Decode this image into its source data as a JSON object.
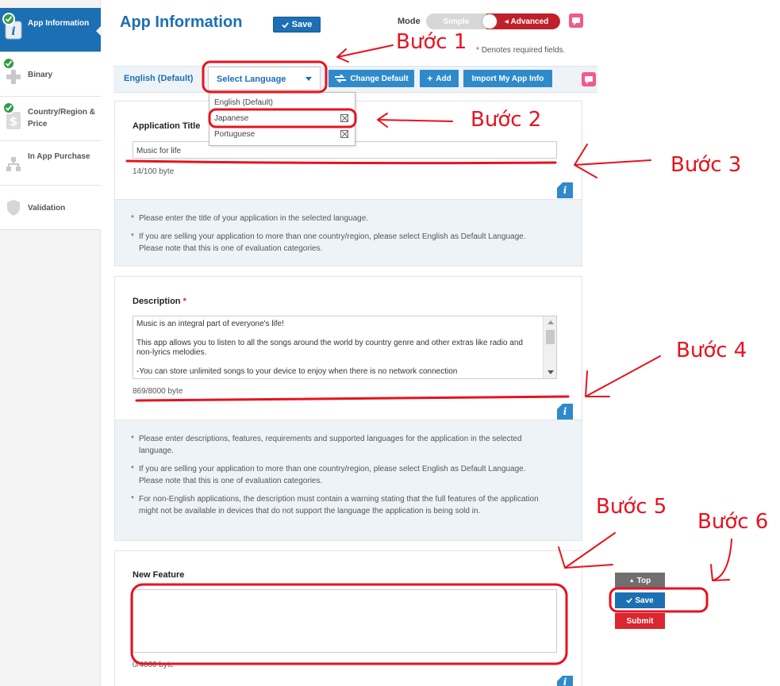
{
  "sidebar": {
    "items": [
      {
        "label": "App Information",
        "icon": "info-icon",
        "checked": true,
        "active": true
      },
      {
        "label": "Binary",
        "icon": "plus-icon",
        "checked": true,
        "active": false
      },
      {
        "label": "Country/Region & Price",
        "icon": "dollar-icon",
        "checked": true,
        "active": false
      },
      {
        "label": "In App Purchase",
        "icon": "network-icon",
        "checked": false,
        "active": false
      },
      {
        "label": "Validation",
        "icon": "shield-icon",
        "checked": false,
        "active": false
      }
    ]
  },
  "header": {
    "title": "App Information",
    "save_label": "Save",
    "mode_label": "Mode",
    "mode_simple": "Simple",
    "mode_advanced": "Advanced",
    "required_note": "Denotes required fields.",
    "required_star": "*"
  },
  "language_bar": {
    "default_tab": "English (Default)",
    "select_label": "Select Language",
    "change_default": "Change Default",
    "add": "Add",
    "import": "Import My App Info",
    "options": [
      "English (Default)",
      "Japanese",
      "Portuguese"
    ]
  },
  "app_title_panel": {
    "label": "Application Title",
    "value": "Music for life",
    "counter": "14/100 byte",
    "help": [
      "Please enter the title of your application in the selected language.",
      "If you are selling your application to more than one country/region, please select English as Default Language. Please note that this is one of evaluation categories."
    ]
  },
  "description_panel": {
    "label": "Description",
    "required_star": "*",
    "value": "Music is an integral part of everyone's life!\n\nThis app allows you to listen to all the songs around the world by country genre and other extras like radio and non-lyrics melodies.\n\n-You can store unlimited songs to your device to enjoy when there is no network connection",
    "counter": "869/8000 byte",
    "help": [
      "Please enter descriptions, features, requirements and supported languages for the application in the selected language.",
      "If you are selling your application to more than one country/region, please select English as Default Language. Please note that this is one of evaluation categories.",
      "For non-English applications, the description must contain a warning stating that the full features of the application might not be available in devices that do not support the language the application is being sold in."
    ]
  },
  "new_feature_panel": {
    "label": "New Feature",
    "value": "",
    "counter": "0/4000 byte"
  },
  "floating": {
    "top": "Top",
    "save": "Save",
    "submit": "Submit"
  },
  "annotations": {
    "step1": "Bước 1",
    "step2": "Bước 2",
    "step3": "Bước 3",
    "step4": "Bước 4",
    "step5": "Bước 5",
    "step6": "Bước 6",
    "color": "#e8121e"
  },
  "colors": {
    "brand_blue": "#1c6fb3",
    "button_blue": "#2f8ac9",
    "advanced_red": "#c0202a",
    "submit_red": "#d9262f",
    "top_gray": "#6f6f6f",
    "check_green": "#2f9b47"
  }
}
